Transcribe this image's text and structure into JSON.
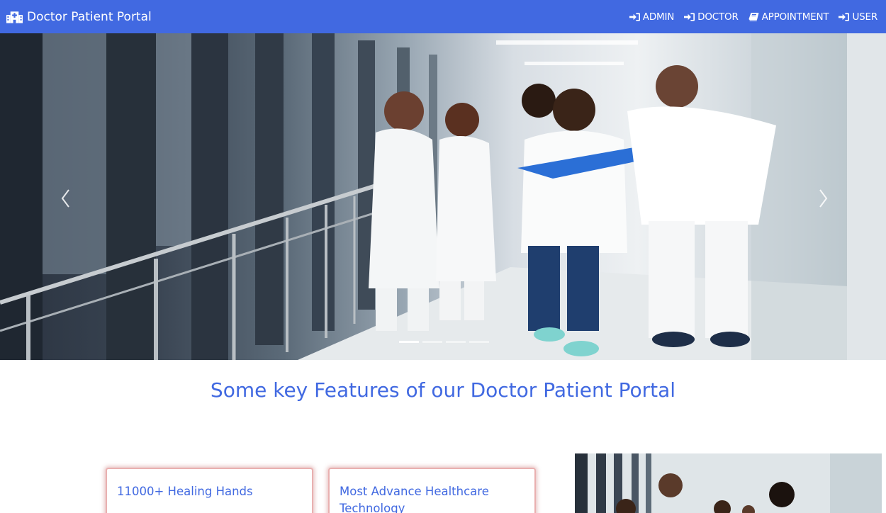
{
  "navbar": {
    "brand": "Doctor Patient Portal",
    "brand_icon": "hospital-icon",
    "links": [
      {
        "label": "ADMIN",
        "icon": "sign-in-icon"
      },
      {
        "label": "DOCTOR",
        "icon": "sign-in-icon"
      },
      {
        "label": "APPOINTMENT",
        "icon": "book-icon"
      },
      {
        "label": "USER",
        "icon": "sign-in-icon"
      }
    ],
    "background": "#4169e1"
  },
  "carousel": {
    "image": "doctors-walking-in-hospital-corridor",
    "indicator_count": 4,
    "active_index": 0,
    "prev_icon": "chevron-left-icon",
    "next_icon": "chevron-right-icon"
  },
  "features": {
    "title": "Some key Features of our Doctor Patient Portal",
    "cards": [
      {
        "title": "11000+ Healing Hands"
      },
      {
        "title": "Most Advance Healthcare Technology"
      }
    ],
    "side_image": "doctors-group-photo"
  },
  "colors": {
    "accent": "#4169e1",
    "card_border": "#e9b0b0"
  }
}
